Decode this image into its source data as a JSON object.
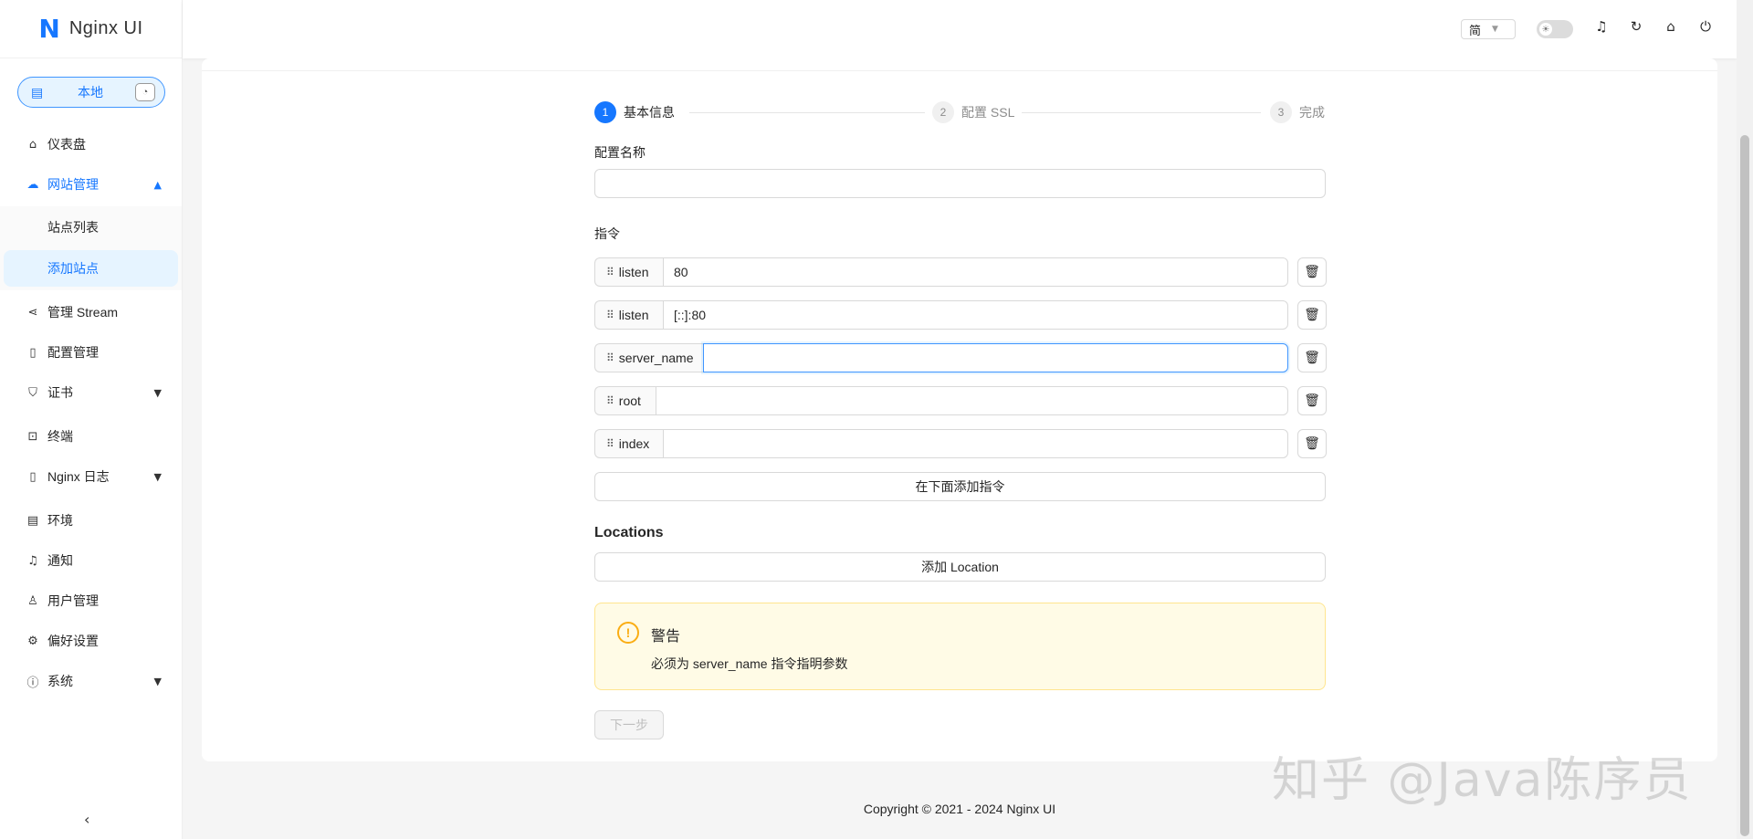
{
  "app": {
    "logo_mark": "N",
    "logo_text": "Nginx UI"
  },
  "environment": {
    "label": "本地"
  },
  "sidebar": {
    "items": [
      {
        "label": "仪表盘",
        "icon": "home-icon"
      },
      {
        "label": "网站管理",
        "icon": "cloud-icon",
        "expanded": true
      },
      {
        "label": "管理 Stream",
        "icon": "share-icon"
      },
      {
        "label": "配置管理",
        "icon": "file-icon"
      },
      {
        "label": "证书",
        "icon": "shield-icon",
        "expandable": true
      },
      {
        "label": "终端",
        "icon": "terminal-icon"
      },
      {
        "label": "Nginx 日志",
        "icon": "file-text-icon",
        "expandable": true
      },
      {
        "label": "环境",
        "icon": "database-icon"
      },
      {
        "label": "通知",
        "icon": "bell-icon"
      },
      {
        "label": "用户管理",
        "icon": "user-icon"
      },
      {
        "label": "偏好设置",
        "icon": "settings-icon"
      },
      {
        "label": "系统",
        "icon": "info-icon",
        "expandable": true
      }
    ],
    "submenu": [
      {
        "label": "站点列表"
      },
      {
        "label": "添加站点",
        "selected": true
      }
    ]
  },
  "header": {
    "language": "简"
  },
  "steps": [
    {
      "number": "1",
      "label": "基本信息",
      "status": "active"
    },
    {
      "number": "2",
      "label": "配置 SSL",
      "status": "wait"
    },
    {
      "number": "3",
      "label": "完成",
      "status": "wait"
    }
  ],
  "form": {
    "config_name_label": "配置名称",
    "config_name_value": "",
    "directives_label": "指令",
    "directives": [
      {
        "name": "listen",
        "value": "80"
      },
      {
        "name": "listen",
        "value": "[::]:80"
      },
      {
        "name": "server_name",
        "value": "",
        "focused": true
      },
      {
        "name": "root",
        "value": ""
      },
      {
        "name": "index",
        "value": ""
      }
    ],
    "add_directive_label": "在下面添加指令",
    "locations_label": "Locations",
    "add_location_label": "添加 Location"
  },
  "alert": {
    "title": "警告",
    "description": "必须为 server_name 指令指明参数",
    "color": "#faad14"
  },
  "next_button": "下一步",
  "footer": "Copyright © 2021 - 2024 Nginx UI",
  "watermark": "知乎 @Java陈序员",
  "colors": {
    "primary": "#1677ff",
    "warning": "#faad14",
    "warning_bg": "#fffbe6"
  }
}
